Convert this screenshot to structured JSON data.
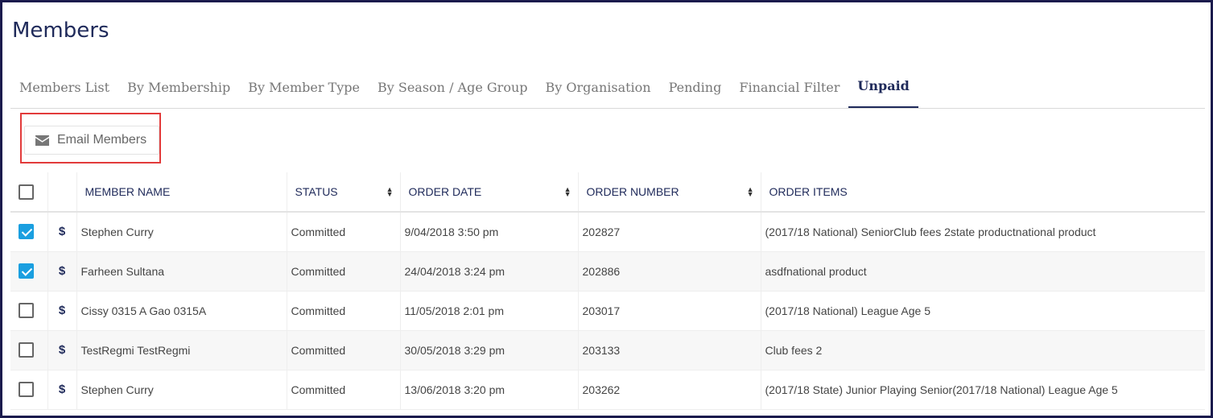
{
  "page": {
    "title": "Members"
  },
  "tabs": [
    {
      "label": "Members List",
      "active": false
    },
    {
      "label": "By Membership",
      "active": false
    },
    {
      "label": "By Member Type",
      "active": false
    },
    {
      "label": "By Season / Age Group",
      "active": false
    },
    {
      "label": "By Organisation",
      "active": false
    },
    {
      "label": "Pending",
      "active": false
    },
    {
      "label": "Financial Filter",
      "active": false
    },
    {
      "label": "Unpaid",
      "active": true
    }
  ],
  "toolbar": {
    "email_label": "Email Members",
    "email_icon": "envelope-icon"
  },
  "table": {
    "columns": [
      "MEMBER NAME",
      "STATUS",
      "ORDER DATE",
      "ORDER NUMBER",
      "ORDER ITEMS"
    ],
    "rows": [
      {
        "checked": true,
        "icon": "$",
        "name": "Stephen Curry",
        "status": "Committed",
        "order_date": "9/04/2018 3:50 pm",
        "order_number": "202827",
        "order_items": "(2017/18 National) SeniorClub fees 2state productnational product"
      },
      {
        "checked": true,
        "icon": "$",
        "name": "Farheen Sultana",
        "status": "Committed",
        "order_date": "24/04/2018 3:24 pm",
        "order_number": "202886",
        "order_items": "asdfnational product"
      },
      {
        "checked": false,
        "icon": "$",
        "name": "Cissy 0315 A Gao 0315A",
        "status": "Committed",
        "order_date": "11/05/2018 2:01 pm",
        "order_number": "203017",
        "order_items": "(2017/18 National) League Age 5"
      },
      {
        "checked": false,
        "icon": "$",
        "name": "TestRegmi TestRegmi",
        "status": "Committed",
        "order_date": "30/05/2018 3:29 pm",
        "order_number": "203133",
        "order_items": "Club fees 2"
      },
      {
        "checked": false,
        "icon": "$",
        "name": "Stephen Curry",
        "status": "Committed",
        "order_date": "13/06/2018 3:20 pm",
        "order_number": "203262",
        "order_items": "(2017/18 State) Junior Playing Senior(2017/18 National) League Age 5"
      }
    ]
  },
  "colors": {
    "accent": "#1f2a5a",
    "checkbox": "#1a9fe0",
    "highlight": "#e23b3b"
  }
}
